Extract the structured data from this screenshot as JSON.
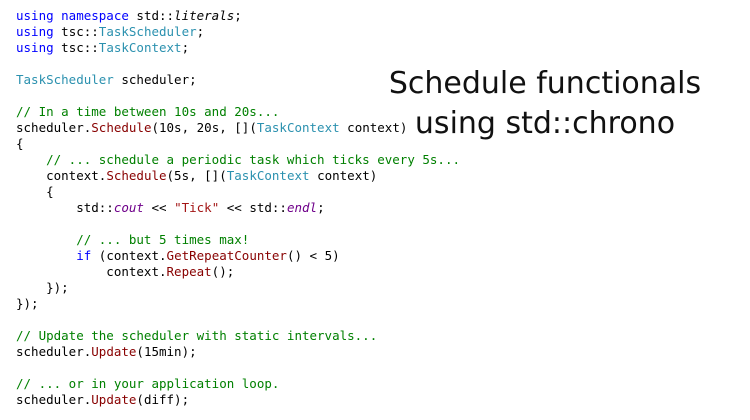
{
  "caption": {
    "line1": "Schedule functionals",
    "line2": "using std::chrono"
  },
  "colors": {
    "keyword": "#0000ff",
    "type": "#2b91af",
    "function": "#880000",
    "comment": "#008000",
    "string": "#a31515"
  },
  "code": {
    "l1": [
      "using namespace",
      " std::",
      "literals",
      ";"
    ],
    "l2": [
      "using",
      " tsc::",
      "TaskScheduler",
      ";"
    ],
    "l3": [
      "using",
      " tsc::",
      "TaskContext",
      ";"
    ],
    "l5": [
      "TaskScheduler",
      " scheduler;"
    ],
    "l7": "// In a time between 10s and 20s...",
    "l8": [
      "scheduler.",
      "Schedule",
      "(10s, 20s, [](",
      "TaskContext",
      " context)"
    ],
    "l9": "{",
    "l10": "    // ... schedule a periodic task which ticks every 5s...",
    "l11": [
      "    context.",
      "Schedule",
      "(5s, [](",
      "TaskContext",
      " context)"
    ],
    "l12": "    {",
    "l13": [
      "        std::",
      "cout",
      " << ",
      "\"Tick\"",
      " << std::",
      "endl",
      ";"
    ],
    "l15": "        // ... but 5 times max!",
    "l16": [
      "        ",
      "if",
      " (context.",
      "GetRepeatCounter",
      "() < 5)"
    ],
    "l17": [
      "            context.",
      "Repeat",
      "();"
    ],
    "l18": "    });",
    "l19": "});",
    "l21": "// Update the scheduler with static intervals...",
    "l22": [
      "scheduler.",
      "Update",
      "(15min);"
    ],
    "l24": "// ... or in your application loop.",
    "l25": [
      "scheduler.",
      "Update",
      "(diff);"
    ]
  }
}
